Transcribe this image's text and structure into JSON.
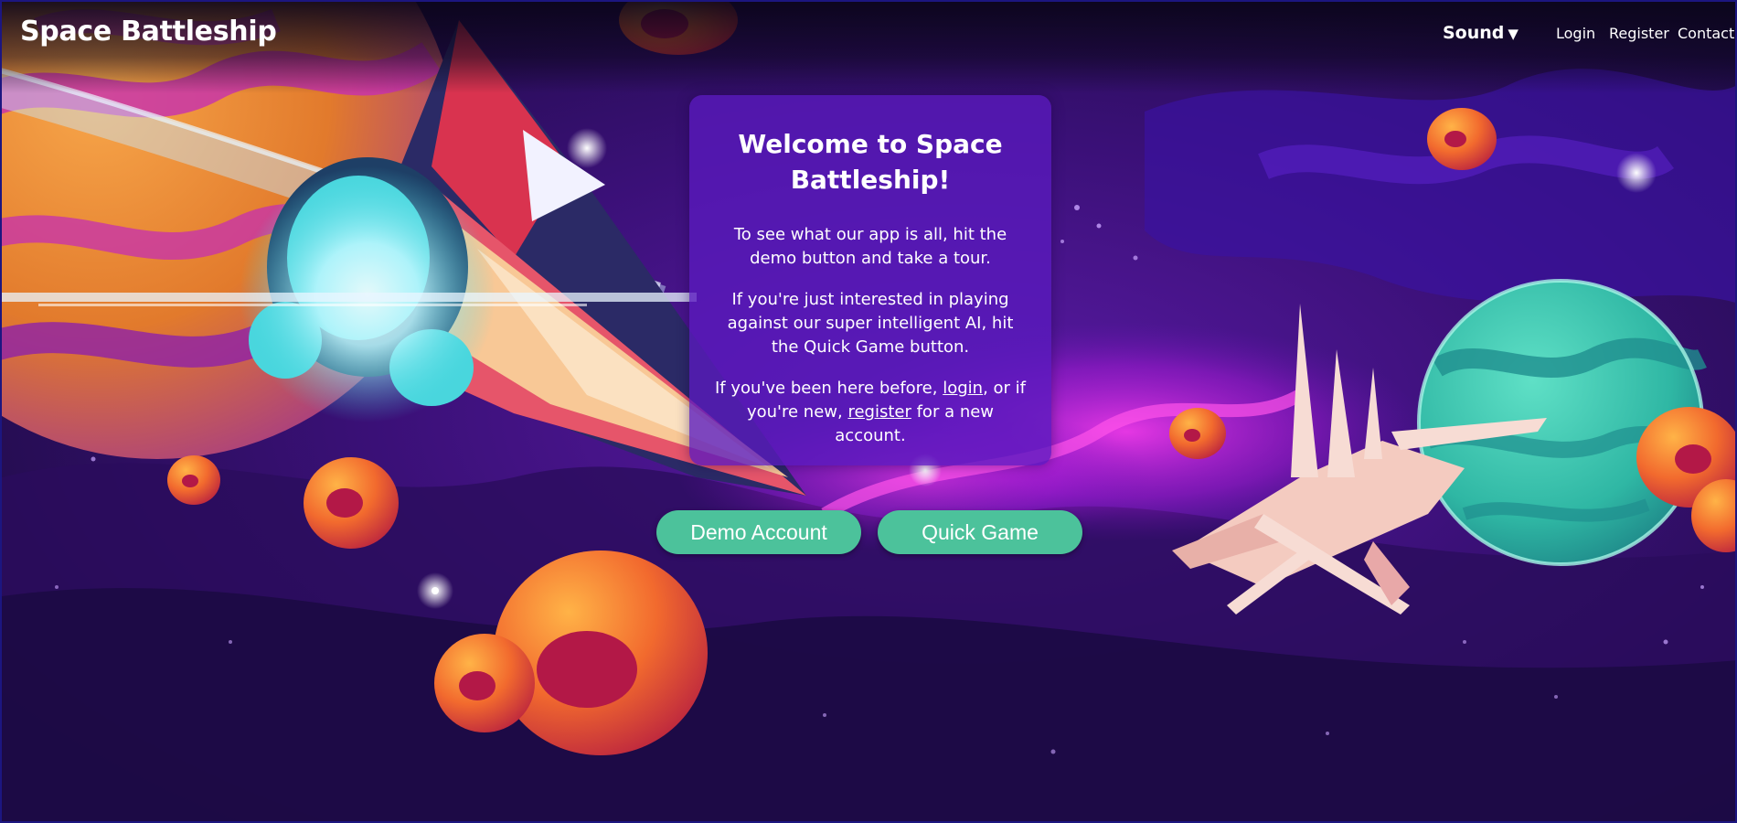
{
  "header": {
    "brand": "Space Battleship",
    "sound_label": "Sound",
    "sound_caret": "▼",
    "nav": {
      "login": "Login",
      "register": "Register",
      "contact": "Contact"
    }
  },
  "welcome": {
    "title": "Welcome to Space Battleship!",
    "para1": "To see what our app is all, hit the demo button and take a tour.",
    "para2": "If you're just interested in playing against our super intelligent AI, hit the Quick Game button.",
    "para3_prefix": "If you've been here before, ",
    "para3_login": "login",
    "para3_middle": ", or if you're new, ",
    "para3_register": "register",
    "para3_suffix": " for a new account."
  },
  "buttons": {
    "demo": "Demo Account",
    "quick": "Quick Game"
  },
  "colors": {
    "button_teal": "#4cc29b",
    "card_purple": "#5a19be",
    "background_deep": "#150830"
  },
  "icons": {
    "sound_caret": "chevron-down-icon"
  }
}
